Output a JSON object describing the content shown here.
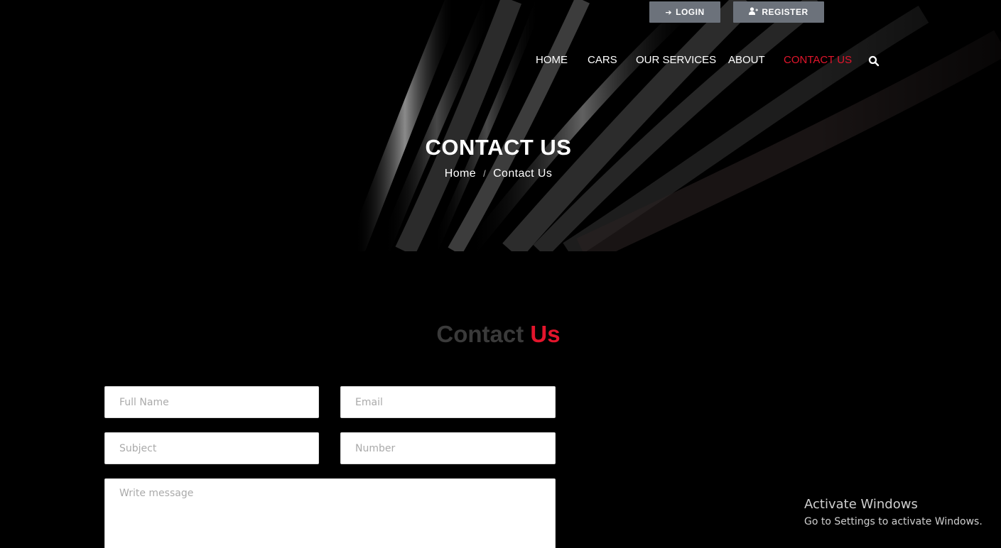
{
  "auth": {
    "login_label": "LOGIN",
    "register_label": "REGISTER"
  },
  "nav": {
    "items": [
      {
        "label": "HOME",
        "active": false
      },
      {
        "label": "CARS",
        "active": false
      },
      {
        "label": "OUR SERVICES",
        "active": false
      },
      {
        "label": "ABOUT",
        "active": false
      },
      {
        "label": "CONTACT US",
        "active": true
      }
    ],
    "search_icon": "search-icon"
  },
  "hero": {
    "title": "CONTACT US",
    "breadcrumb": {
      "home": "Home",
      "separator": "/",
      "current": "Contact Us"
    }
  },
  "section": {
    "title_part1": "Contact",
    "title_part2": "Us"
  },
  "form": {
    "full_name_placeholder": "Full Name",
    "email_placeholder": "Email",
    "subject_placeholder": "Subject",
    "number_placeholder": "Number",
    "message_placeholder": "Write message"
  },
  "watermark": {
    "line1": "Activate Windows",
    "line2": "Go to Settings to activate Windows."
  },
  "colors": {
    "accent": "#e3152c",
    "auth_button_bg": "#6c727b",
    "background": "#000000"
  }
}
